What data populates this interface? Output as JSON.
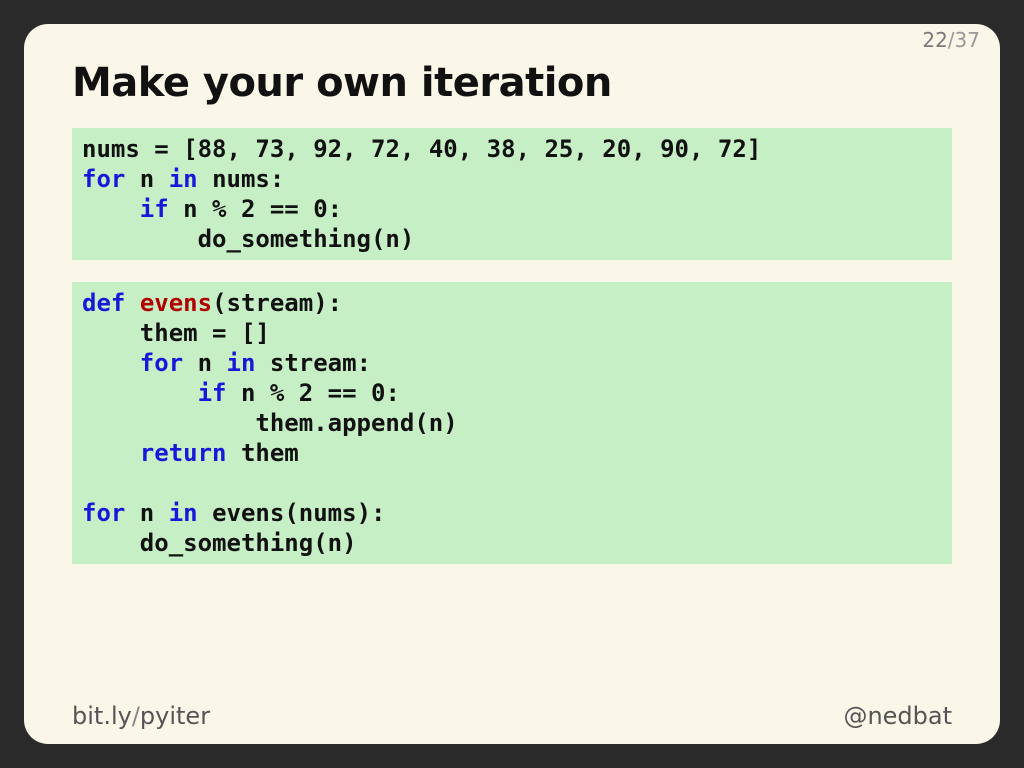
{
  "page": {
    "current": "22",
    "total": "37",
    "sep": "/"
  },
  "title": "Make your own iteration",
  "code1": {
    "l1a": "nums = [",
    "l1b": "88",
    "l1c": ", ",
    "l1d": "73",
    "l1e": ", ",
    "l1f": "92",
    "l1g": ", ",
    "l1h": "72",
    "l1i": ", ",
    "l1j": "40",
    "l1k": ", ",
    "l1l": "38",
    "l1m": ", ",
    "l1n": "25",
    "l1o": ", ",
    "l1p": "20",
    "l1q": ", ",
    "l1r": "90",
    "l1s": ", ",
    "l1t": "72",
    "l1u": "]",
    "l2a": "for",
    "l2b": " n ",
    "l2c": "in",
    "l2d": " nums:",
    "l3a": "    ",
    "l3b": "if",
    "l3c": " n % ",
    "l3d": "2",
    "l3e": " == ",
    "l3f": "0",
    "l3g": ":",
    "l4a": "        do_something(n)"
  },
  "code2": {
    "l1a": "def",
    "l1b": " ",
    "l1c": "evens",
    "l1d": "(stream):",
    "l2a": "    them = []",
    "l3a": "    ",
    "l3b": "for",
    "l3c": " n ",
    "l3d": "in",
    "l3e": " stream:",
    "l4a": "        ",
    "l4b": "if",
    "l4c": " n % ",
    "l4d": "2",
    "l4e": " == ",
    "l4f": "0",
    "l4g": ":",
    "l5a": "            them.append(n)",
    "l6a": "    ",
    "l6b": "return",
    "l6c": " them",
    "l7a": "",
    "l8a": "for",
    "l8b": " n ",
    "l8c": "in",
    "l8d": " evens(nums):",
    "l9a": "    do_something(n)"
  },
  "footer": {
    "link_pre": "bit.ly",
    "link_sep": "/",
    "link_post": "pyiter",
    "handle": "@nedbat"
  }
}
